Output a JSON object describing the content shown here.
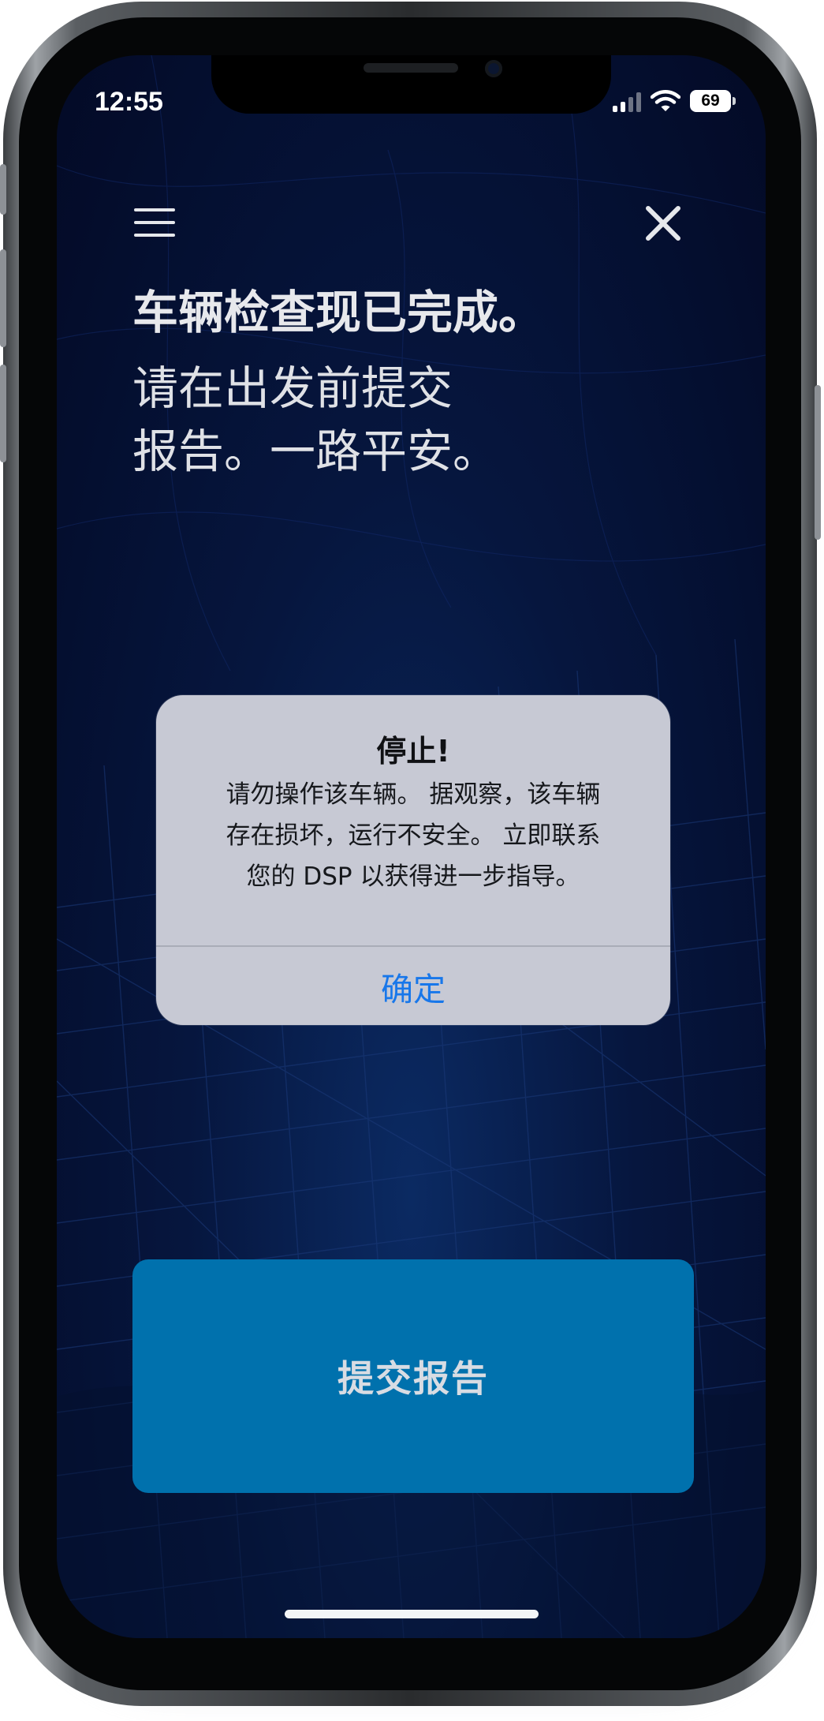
{
  "status_bar": {
    "time": "12:55",
    "battery": "69"
  },
  "header": {
    "menu_icon": "hamburger-menu-icon",
    "close_icon": "close-x-icon"
  },
  "main": {
    "headline": "车辆检查现已完成。",
    "subline_1": "请在出发前提交",
    "subline_2": "报告。一路平安。"
  },
  "alert": {
    "title": "停止!",
    "message_line_1": "请勿操作该车辆。 据观察，该车辆",
    "message_line_2": "存在损坏，运行不安全。 立即联系",
    "message_line_3": "您的 DSP 以获得进一步指导。",
    "button_label": "确定"
  },
  "footer": {
    "submit_label": "提交报告"
  },
  "colors": {
    "background": "#06163e",
    "submit_button": "#0071ad",
    "alert_background": "#c7c9d4",
    "alert_button_text": "#1877ea"
  }
}
